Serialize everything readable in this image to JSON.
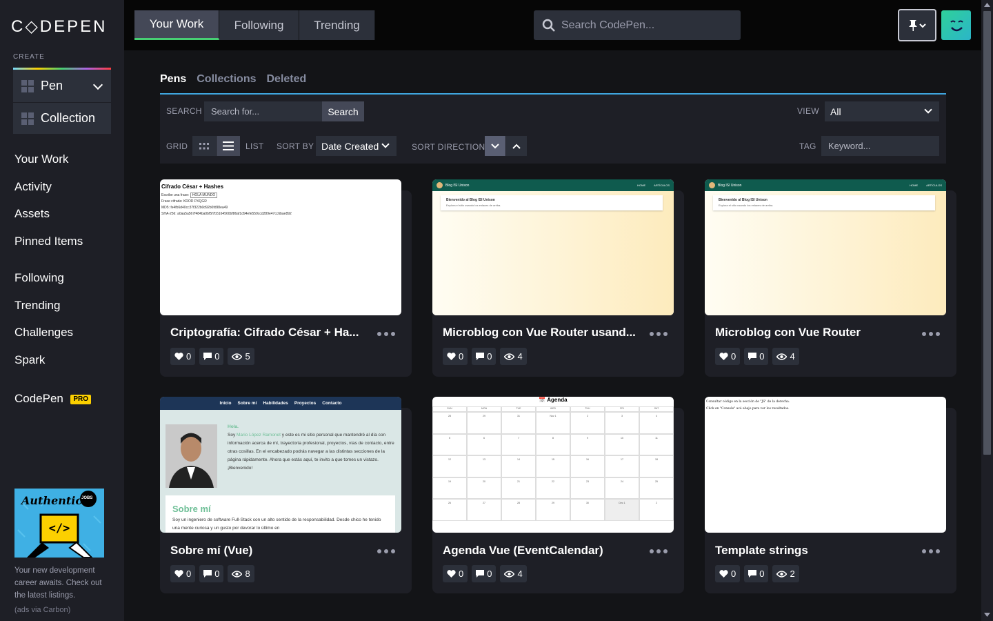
{
  "sidebar": {
    "logo_text": "C◇DEPEN",
    "create_label": "CREATE",
    "create_items": [
      {
        "label": "Pen"
      },
      {
        "label": "Collection"
      }
    ],
    "nav_primary": [
      "Your Work",
      "Activity",
      "Assets",
      "Pinned Items"
    ],
    "nav_secondary": [
      "Following",
      "Trending",
      "Challenges",
      "Spark"
    ],
    "codepen_label": "CodePen",
    "pro_badge": "PRO",
    "ad": {
      "image_text": "Authentic",
      "image_badge": "JOBS",
      "text": "Your new development career awaits. Check out the latest listings.",
      "via": "(ads via Carbon)"
    }
  },
  "header": {
    "tabs": [
      "Your Work",
      "Following",
      "Trending"
    ],
    "active_tab": "Your Work",
    "search_placeholder": "Search CodePen..."
  },
  "main": {
    "subtabs": [
      "Pens",
      "Collections",
      "Deleted"
    ],
    "active_subtab": "Pens",
    "filters": {
      "search_label": "SEARCH",
      "search_placeholder": "Search for...",
      "search_button": "Search",
      "view_label": "VIEW",
      "view_value": "All",
      "grid_label": "GRID",
      "list_label": "LIST",
      "sort_by_label": "SORT BY",
      "sort_by_value": "Date Created",
      "sort_direction_label": "SORT DIRECTION",
      "tag_label": "TAG",
      "tag_placeholder": "Keyword..."
    },
    "pens": [
      {
        "title": "Criptografía: Cifrado César + Ha...",
        "likes": "0",
        "comments": "0",
        "views": "5"
      },
      {
        "title": "Microblog con Vue Router usand...",
        "likes": "0",
        "comments": "0",
        "views": "4"
      },
      {
        "title": "Microblog con Vue Router",
        "likes": "0",
        "comments": "0",
        "views": "4"
      },
      {
        "title": "Sobre mí (Vue)",
        "likes": "0",
        "comments": "0",
        "views": "8"
      },
      {
        "title": "Agenda Vue (EventCalendar)",
        "likes": "0",
        "comments": "0",
        "views": "4"
      },
      {
        "title": "Template strings",
        "likes": "0",
        "comments": "0",
        "views": "2"
      }
    ],
    "previews": {
      "cipher": {
        "title": "Cifrado César + Hashes",
        "line1": "Escribe una frase:",
        "line1_value": "HOLA MUNDO",
        "line2": "Frase cifrada: KROD PXQGR",
        "line3": "MD5: fe4fb6d40cc37f322b0d92b0fd98ea49",
        "line4": "SHA-256: a0aa5a567f484ba0bf5f7b5164560bf86af1d94efe559ccd289e47cc6bae892"
      },
      "blog": {
        "brand": "Blog ISI Unison",
        "nav1": "HOME",
        "nav2": "ARTÍCULOS",
        "welcome": "Bienvenido al Blog ISI Unison",
        "sub": "Explora el sitio usando los enlaces de arriba."
      },
      "about": {
        "nav": [
          "Inicio",
          "Sobre mí",
          "Habilidades",
          "Proyectos",
          "Contacto"
        ],
        "greeting": "Hola.",
        "text_a": "Soy",
        "name": "Mario López Ramonet",
        "text_b": "y este es mi sitio personal que mantendré al día con información acerca de mí, trayectoria profesional, proyectos, vías de contacto, entre otras cosillas. En el encabezado podrás navegar a las distintas secciones de la página rápidamente. Ahora que estás aquí, te invito a que tomes un vistazo.",
        "welcome": "¡Bienvenido!",
        "section": "Sobre mí",
        "section_text": "Soy un ingeniero de software Full-Stack con un alto sentido de la responsabilidad. Desde chico he tenido una mente curiosa y un gusto por devorar lo último en"
      },
      "agenda": {
        "title": "📅 Agenda",
        "days": [
          "SUN",
          "MON",
          "TUE",
          "WED",
          "THU",
          "FRI",
          "SAT"
        ],
        "weeks": [
          [
            "28",
            "29",
            "31",
            "Nov 1",
            "2",
            "3",
            "4"
          ],
          [
            "5",
            "6",
            "7",
            "8",
            "9",
            "10",
            "11"
          ],
          [
            "12",
            "13",
            "14",
            "15",
            "16",
            "17",
            "18"
          ],
          [
            "19",
            "20",
            "21",
            "22",
            "23",
            "24",
            "25"
          ],
          [
            "26",
            "27",
            "28",
            "29",
            "30",
            "Dec 1",
            "2"
          ]
        ]
      },
      "template": {
        "line1": "Consultar código en la sección de \"JS\" de la derecha.",
        "line2": "Click en \"Console\" acá abajo para ver los resultados."
      }
    }
  },
  "colors": {
    "accent_green": "#47cf73",
    "accent_blue": "#3fa5de",
    "pro_yellow": "#fcd000"
  }
}
